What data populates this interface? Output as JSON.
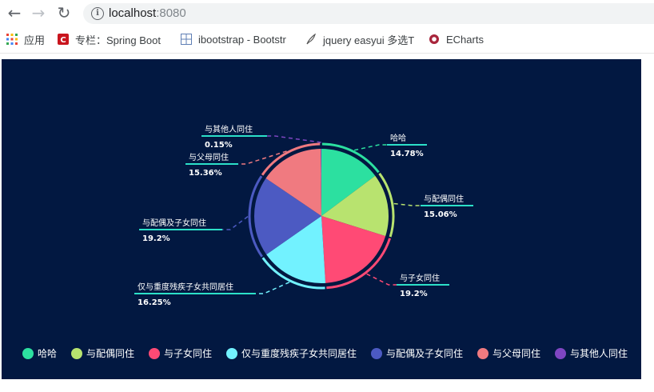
{
  "browser": {
    "url_host": "localhost",
    "url_port": ":8080",
    "bookmarks": [
      {
        "label": "应用",
        "icon": "apps-grid-icon"
      },
      {
        "label": "专栏：Spring Boot",
        "icon": "csdn-icon"
      },
      {
        "label": "ibootstrap - Bootstr",
        "icon": "grid-icon"
      },
      {
        "label": "jquery easyui 多选T",
        "icon": "feather-icon"
      },
      {
        "label": "ECharts",
        "icon": "echarts-icon"
      }
    ]
  },
  "chart_data": {
    "type": "pie",
    "title": "",
    "categories": [
      "哈哈",
      "与配偶同住",
      "与子女同住",
      "仅与重度残疾子女共同居住",
      "与配偶及子女同住",
      "与父母同住",
      "与其他人同住"
    ],
    "values": [
      14.78,
      15.06,
      19.2,
      16.25,
      19.2,
      15.36,
      0.15
    ],
    "percent_labels": [
      "14.78%",
      "15.06%",
      "19.2%",
      "16.25%",
      "19.2%",
      "15.36%",
      "0.15%"
    ],
    "colors": [
      "#2ce0a0",
      "#b8e36f",
      "#ff4a75",
      "#72f2ff",
      "#4c5ac2",
      "#f07a80",
      "#7f46c2"
    ],
    "legend_position": "bottom",
    "background": "#021841"
  }
}
